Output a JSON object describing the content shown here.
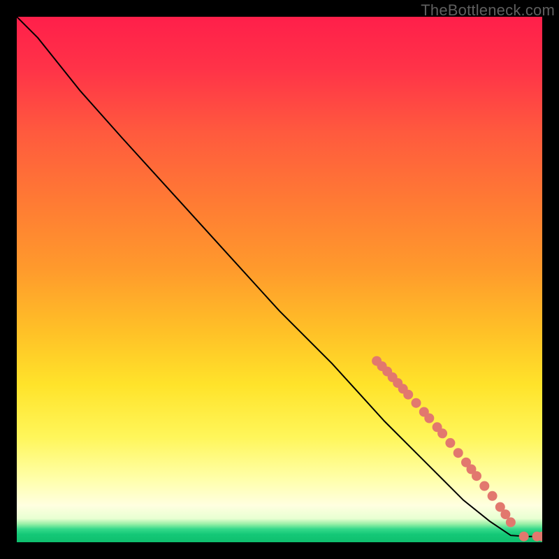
{
  "watermark": "TheBottleneck.com",
  "colors": {
    "marker": "#e2786e",
    "line": "#000000"
  },
  "chart_data": {
    "type": "line",
    "title": "",
    "xlabel": "",
    "ylabel": "",
    "xlim": [
      0,
      100
    ],
    "ylim": [
      0,
      100
    ],
    "grid": false,
    "legend": false,
    "background_gradient_notes": "vertical gradient: red→orange→yellow→pale-yellow→narrow green band at bottom",
    "curve": [
      {
        "x": 0,
        "y": 100
      },
      {
        "x": 4,
        "y": 96
      },
      {
        "x": 8,
        "y": 91
      },
      {
        "x": 12,
        "y": 86
      },
      {
        "x": 20,
        "y": 77
      },
      {
        "x": 30,
        "y": 66
      },
      {
        "x": 40,
        "y": 55
      },
      {
        "x": 50,
        "y": 44
      },
      {
        "x": 60,
        "y": 34
      },
      {
        "x": 70,
        "y": 23
      },
      {
        "x": 78,
        "y": 15
      },
      {
        "x": 85,
        "y": 8
      },
      {
        "x": 90,
        "y": 4
      },
      {
        "x": 94,
        "y": 1.3
      },
      {
        "x": 97,
        "y": 1.1
      },
      {
        "x": 100,
        "y": 1.1
      }
    ],
    "markers": [
      {
        "x": 68.5,
        "y": 34.5
      },
      {
        "x": 69.5,
        "y": 33.5
      },
      {
        "x": 70.5,
        "y": 32.5
      },
      {
        "x": 71.5,
        "y": 31.4
      },
      {
        "x": 72.5,
        "y": 30.3
      },
      {
        "x": 73.5,
        "y": 29.2
      },
      {
        "x": 74.5,
        "y": 28.1
      },
      {
        "x": 76.0,
        "y": 26.5
      },
      {
        "x": 77.5,
        "y": 24.8
      },
      {
        "x": 78.5,
        "y": 23.6
      },
      {
        "x": 80.0,
        "y": 21.9
      },
      {
        "x": 81.0,
        "y": 20.7
      },
      {
        "x": 82.5,
        "y": 18.9
      },
      {
        "x": 84.0,
        "y": 17.0
      },
      {
        "x": 85.5,
        "y": 15.2
      },
      {
        "x": 86.5,
        "y": 13.9
      },
      {
        "x": 87.5,
        "y": 12.6
      },
      {
        "x": 89.0,
        "y": 10.7
      },
      {
        "x": 90.5,
        "y": 8.8
      },
      {
        "x": 92.0,
        "y": 6.7
      },
      {
        "x": 93.0,
        "y": 5.3
      },
      {
        "x": 94.0,
        "y": 3.8
      },
      {
        "x": 96.5,
        "y": 1.1
      },
      {
        "x": 99.0,
        "y": 1.1
      },
      {
        "x": 100.0,
        "y": 1.1
      }
    ]
  }
}
